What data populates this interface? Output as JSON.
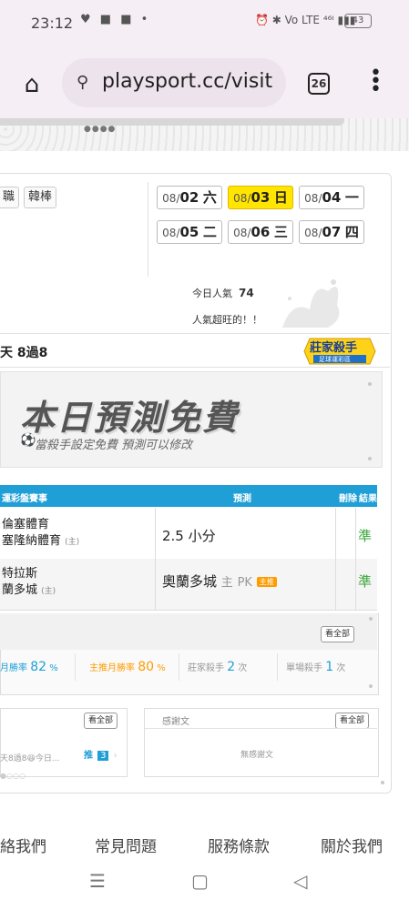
{
  "status": {
    "time": "23:12",
    "notif_icons": "♥ ■ ■ •",
    "right_icons": "⏰ ✱ Vo LTE ⁴⁶ᴵ ▮▮▮",
    "battery": "43"
  },
  "browser": {
    "url": "playsport.cc/visit",
    "tab_count": "26"
  },
  "tags": [
    "職",
    "韓棒"
  ],
  "dates": [
    {
      "prefix": "08/",
      "day": "02",
      "weekday": "六"
    },
    {
      "prefix": "08/",
      "day": "03",
      "weekday": "日"
    },
    {
      "prefix": "08/",
      "day": "04",
      "weekday": "一"
    },
    {
      "prefix": "08/",
      "day": "05",
      "weekday": "二"
    },
    {
      "prefix": "08/",
      "day": "06",
      "weekday": "三"
    },
    {
      "prefix": "08/",
      "day": "07",
      "weekday": "四"
    }
  ],
  "popularity": {
    "label": "今日人氣",
    "value": "74",
    "note": "人氣超旺的！！"
  },
  "streak": "天 8過8",
  "badge": {
    "title": "莊家殺手",
    "subtitle": "足球運彩區"
  },
  "free": {
    "title": "本日預測免費",
    "subtitle": "當殺手設定免費 預測可以修改"
  },
  "table": {
    "headers": {
      "event": "運彩盤賽事",
      "prediction": "預測",
      "delete": "刪除",
      "result": "結果"
    },
    "rows": [
      {
        "team1": "倫塞體育",
        "team2": "塞隆納體育",
        "host": "(主)",
        "prediction": "2.5 小分",
        "side": "",
        "pk": "",
        "tag": "",
        "result": "準"
      },
      {
        "team1": "特拉斯",
        "team2": "蘭多城",
        "host": "(主)",
        "prediction": "奧蘭多城",
        "side": "主",
        "pk": "PK",
        "tag": "主推",
        "result": "準"
      }
    ]
  },
  "stats": {
    "see_all": "看全部",
    "month_win_label": "月勝率",
    "month_win_value": "82",
    "top_month_label": "主推月勝率",
    "top_month_value": "80",
    "banker_label": "莊家殺手",
    "banker_value": "2",
    "banker_unit": "次",
    "single_label": "單場殺手",
    "single_value": "1",
    "single_unit": "次",
    "percent": "%"
  },
  "panels": {
    "left_see_all": "看全部",
    "left_text": "天8過8😆今日...",
    "push_label": "推",
    "push_num": "3",
    "right_title": "感謝文",
    "right_see_all": "看全部",
    "right_empty": "無感謝文"
  },
  "footer": [
    "絡我們",
    "常見問題",
    "服務條款",
    "關於我們"
  ],
  "nav": {
    "menu": "☰",
    "home": "▢",
    "back": "◁"
  }
}
